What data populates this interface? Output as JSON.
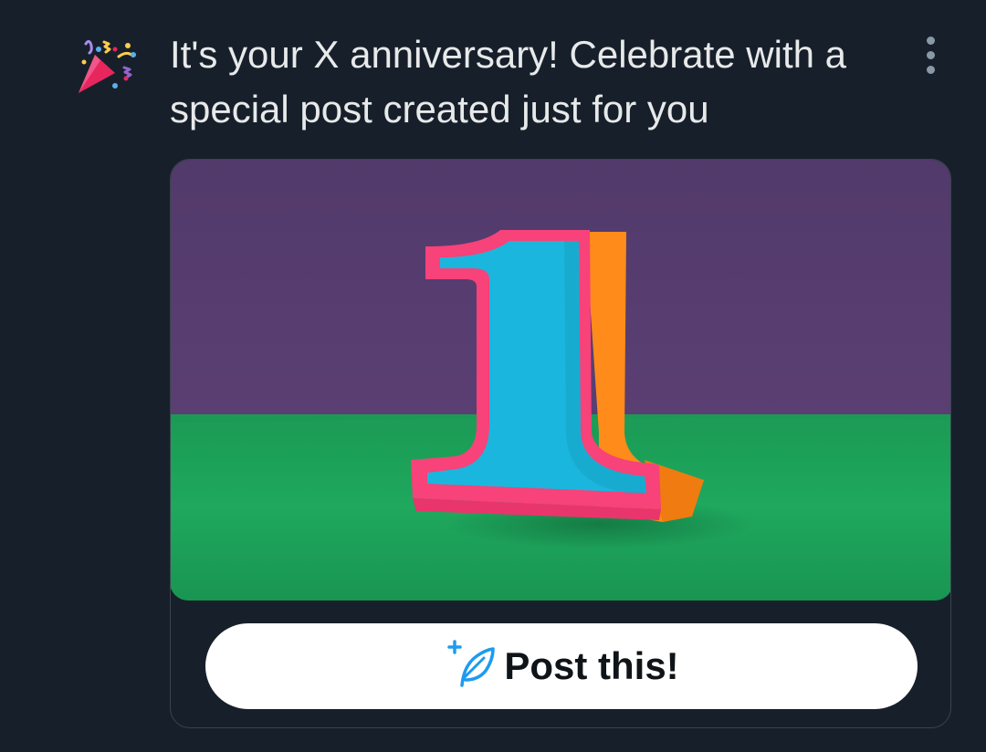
{
  "notification": {
    "icon": "party-popper-icon",
    "text": "It's your X anniversary! Celebrate with a special post created just for you",
    "menu_icon": "more-vertical-icon"
  },
  "card": {
    "image": "number-one-papercraft-illustration",
    "colors": {
      "background_top": "#523a6b",
      "background_floor": "#1ea55d",
      "number_face": "#1bb6dd",
      "number_outline": "#f7427a",
      "number_side": "#ff8c1a"
    },
    "button": {
      "icon": "compose-feather-icon",
      "label": "Post this!"
    }
  },
  "theme": {
    "background": "#17202a",
    "text": "#e7e9ea",
    "accent": "#1d9bf0"
  }
}
